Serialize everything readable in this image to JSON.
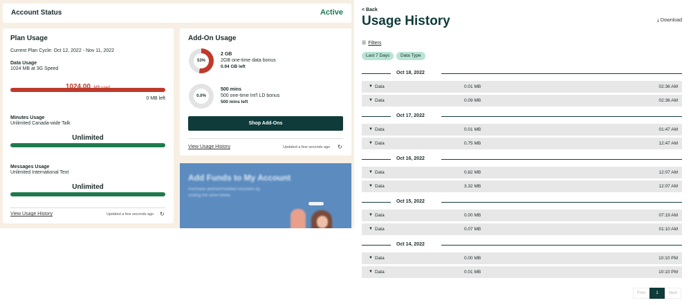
{
  "account": {
    "title": "Account Status",
    "status": "Active"
  },
  "plan": {
    "title": "Plan Usage",
    "cycle": "Current Plan Cycle: Oct 12, 2022 - Nov 11, 2022",
    "data_title": "Data Usage",
    "data_sub": "1024 MB at 3G Speed",
    "data_used_value": "1024.00",
    "data_used_unit": "MB used",
    "data_left": "0 MB left",
    "data_fill": 1.0,
    "minutes_title": "Minutes Usage",
    "minutes_sub": "Unlimited Canada-wide Talk",
    "minutes_value": "Unlimited",
    "messages_title": "Messages Usage",
    "messages_sub": "Unlimited International Text",
    "messages_value": "Unlimited",
    "history_link": "View Usage History",
    "updated": "Updated a few seconds ago"
  },
  "addon": {
    "title": "Add-On Usage",
    "items": [
      {
        "percent": "53%",
        "fill": 0.53,
        "name": "2 GB",
        "desc": "2GB one-time data bonus",
        "left": "0.94 GB left"
      },
      {
        "percent": "0.0%",
        "fill": 0.0,
        "name": "500 mins",
        "desc": "500 one-time Int'l LD bonus",
        "left": "500 mins left"
      }
    ],
    "shop_button": "Shop Add-Ons",
    "history_link": "View Usage History",
    "updated": "Updated a few seconds ago"
  },
  "promo": {
    "title": "Add Funds to My Account",
    "line1": "Purchase airtime/Prebilled vouchers by",
    "line2": "visiting the store below."
  },
  "history": {
    "back": "< Back",
    "title": "Usage History",
    "download": "Download",
    "filters": "Filters",
    "chips": [
      "Last 7 Days",
      "Data Type"
    ],
    "groups": [
      {
        "date": "Oct 18, 2022",
        "rows": [
          {
            "type": "Data",
            "amount": "0.01 MB",
            "time": "02:36 AM"
          },
          {
            "type": "Data",
            "amount": "0.09 MB",
            "time": "02:36 AM"
          }
        ]
      },
      {
        "date": "Oct 17, 2022",
        "rows": [
          {
            "type": "Data",
            "amount": "0.01 MB",
            "time": "01:47 AM"
          },
          {
            "type": "Data",
            "amount": "0.75 MB",
            "time": "12:47 AM"
          }
        ]
      },
      {
        "date": "Oct 16, 2022",
        "rows": [
          {
            "type": "Data",
            "amount": "0.82 MB",
            "time": "12:07 AM"
          },
          {
            "type": "Data",
            "amount": "3.32 MB",
            "time": "12:07 AM"
          }
        ]
      },
      {
        "date": "Oct 15, 2022",
        "rows": [
          {
            "type": "Data",
            "amount": "0.00 MB",
            "time": "07:19 AM"
          },
          {
            "type": "Data",
            "amount": "0.07 MB",
            "time": "01:10 AM"
          }
        ]
      },
      {
        "date": "Oct 14, 2022",
        "rows": [
          {
            "type": "Data",
            "amount": "0.00 MB",
            "time": "10:10 PM"
          },
          {
            "type": "Data",
            "amount": "0.01 MB",
            "time": "10:10 PM"
          }
        ]
      }
    ],
    "pager": {
      "prev": "Prev",
      "current": "1",
      "next": "Next"
    }
  },
  "colors": {
    "accent": "#0f3b3b",
    "green": "#1e7a4e",
    "red": "#c0392b",
    "chip": "#b8e4d4"
  },
  "icons": [
    "refresh-icon",
    "download-icon",
    "filter-icon",
    "wifi-icon"
  ]
}
